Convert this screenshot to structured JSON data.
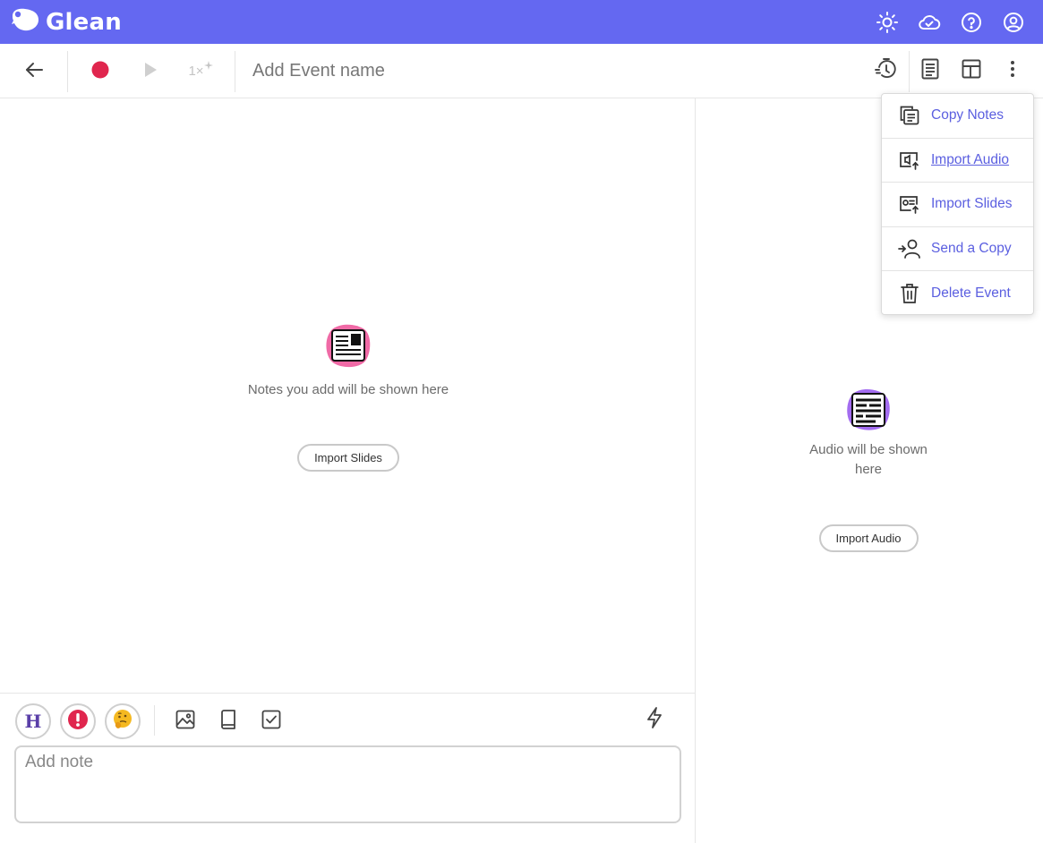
{
  "app": {
    "name": "Glean"
  },
  "header": {
    "icons": [
      "sun-icon",
      "cloud-check-icon",
      "help-icon",
      "account-icon"
    ]
  },
  "toolbar": {
    "back_icon": "arrow-left-icon",
    "speed_label": "1×",
    "event_name_placeholder": "Add Event name",
    "right_icons": [
      "timer-icon",
      "document-icon",
      "layout-icon",
      "more-vert-icon"
    ]
  },
  "notes_panel": {
    "empty_text": "Notes you add will be shown here",
    "import_button": "Import Slides"
  },
  "audio_panel": {
    "empty_text": "Audio will be shown here",
    "import_button": "Import Audio"
  },
  "menu": {
    "items": [
      {
        "label": "Copy Notes",
        "icon": "copy-icon"
      },
      {
        "label": "Import Audio",
        "icon": "import-audio-icon"
      },
      {
        "label": "Import Slides",
        "icon": "import-slides-icon"
      },
      {
        "label": "Send a Copy",
        "icon": "send-user-icon"
      },
      {
        "label": "Delete Event",
        "icon": "trash-icon"
      }
    ]
  },
  "note_toolbar": {
    "heading_label": "H",
    "icons": [
      "heading-icon",
      "important-icon",
      "thinking-icon",
      "image-icon",
      "book-icon",
      "checkbox-icon",
      "lightning-icon"
    ]
  },
  "note_input": {
    "placeholder": "Add note"
  },
  "colors": {
    "brand": "#6468f1",
    "record": "#e0264e",
    "menu_text": "#5b5fe0",
    "heading": "#5a3fa8"
  }
}
